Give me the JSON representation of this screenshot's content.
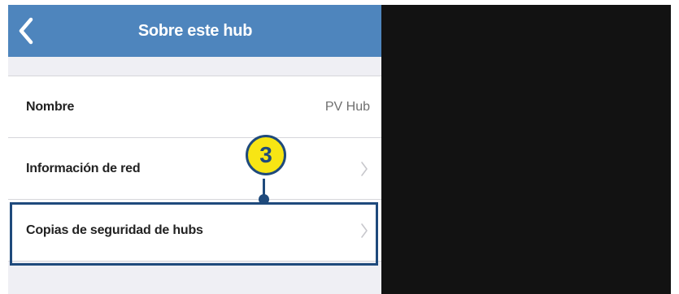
{
  "header": {
    "title": "Sobre este hub",
    "back_icon": "chevron-left-icon"
  },
  "rows": [
    {
      "label": "Nombre",
      "value": "PV Hub"
    },
    {
      "label": "Información de red",
      "icon": "chevron-right-icon"
    },
    {
      "label": "Copias de seguridad de hubs",
      "icon": "chevron-right-icon"
    }
  ],
  "callout": {
    "number": "3"
  },
  "colors": {
    "nav_bar": "#4e85bd",
    "background": "#efeff4",
    "dark_area": "#121212",
    "callout_fill": "#f7e514",
    "callout_stroke": "#1f4a7c"
  }
}
